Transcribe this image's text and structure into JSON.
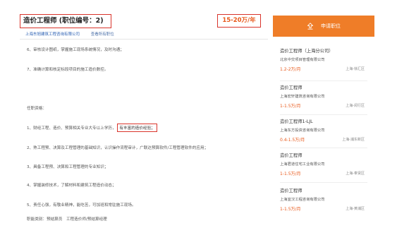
{
  "header": {
    "title": "造价工程师 (职位编号：2)",
    "company": "上海东旭建筑工程咨询有限公司",
    "view_more": "查看所有职位",
    "salary": "15-20万/年"
  },
  "apply_button": {
    "label": "申请职位",
    "icon": "upload-icon"
  },
  "description": {
    "lines": [
      "6、审核设计图纸，掌握施工现场系统情况，及时沟通；",
      "7、准确计算和核定标段项目的施工造价数控。",
      "任职资格：",
      "1、财经工程、造价、预算相关专业大专以上学历，",
      "2、熟工程预、决算及工程管理的基础知识，认识操作流程审计，广联达预算软件/工程管理软件的应用；",
      "3、具备工程预、决算和工程管理的专业知识；",
      "4、掌握装修技术，了解材料和建筑工程造价动态；",
      "5、责任心强，有敬业精神，能吃苦，可加班和常驻施工现场。",
      "职能类别：预结算员　工程造价师/预结算经理"
    ],
    "highlight": "有丰富的造价经验；"
  },
  "sidebar": {
    "items": [
      {
        "title": "造价工程师（上海分公司）",
        "company": "北京中交项目管理有限公司",
        "salary": "1.2-2万/月",
        "location": "上海-徐汇区"
      },
      {
        "title": "造价工程师",
        "company": "上海宏轩建筑咨询有限公司",
        "salary": "1-1.5万/月",
        "location": "上海-闵行区"
      },
      {
        "title": "造价工程师1-LJL",
        "company": "上海东方投资咨询有限公司",
        "salary": "0.4-1.5万/月",
        "location": "上海-浦东新区"
      },
      {
        "title": "造价工程师",
        "company": "上海君道住宅工业有限公司",
        "salary": "1-1.5万/月",
        "location": "上海-奉贤区"
      },
      {
        "title": "造价工程师",
        "company": "上海宜汉工程咨询有限公司",
        "salary": "1-1.5万/月",
        "location": "上海-黄浦区"
      }
    ]
  },
  "colors": {
    "accent": "#ef7d28",
    "salary": "#e8581a",
    "highlight_border": "#d9342b",
    "link": "#2a5fb3"
  }
}
